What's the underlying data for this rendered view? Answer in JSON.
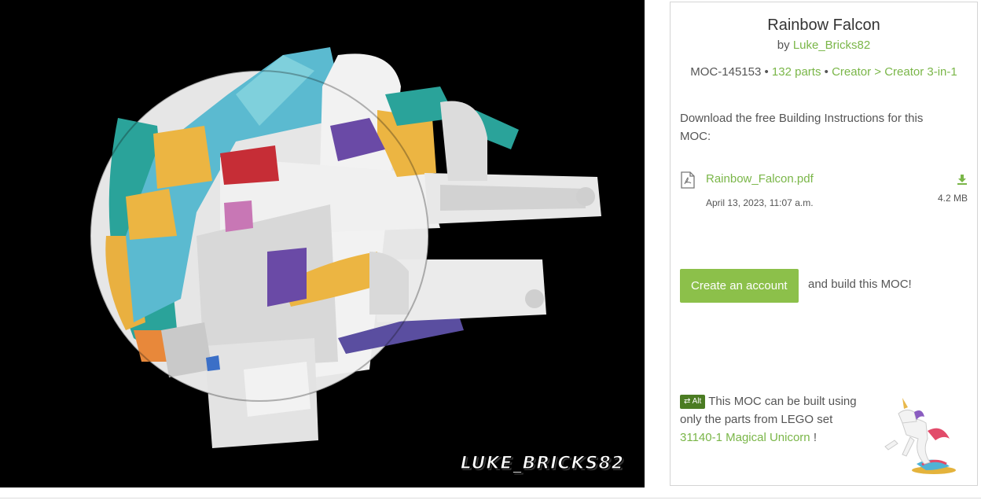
{
  "moc": {
    "title": "Rainbow Falcon",
    "by_prefix": "by",
    "author": "Luke_Bricks82",
    "id": "MOC-145153",
    "separator": "•",
    "parts": "132 parts",
    "category": "Creator > Creator 3-in-1"
  },
  "image": {
    "watermark": "LUKE_BRICKS82"
  },
  "download": {
    "intro": "Download the free Building Instructions for this MOC:",
    "file_name": "Rainbow_Falcon.pdf",
    "file_date": "April 13, 2023, 11:07 a.m.",
    "file_size": "4.2 MB",
    "file_icon": "pdf-file-icon",
    "download_icon": "download-icon"
  },
  "cta": {
    "button_label": "Create an account",
    "after_text": "and build this MOC!"
  },
  "alt": {
    "badge_label": "Alt",
    "badge_icon": "swap-icon",
    "text_before": "This MOC can be built using only the parts from LEGO set",
    "set_link": "31140-1 Magical Unicorn",
    "text_after": "!"
  },
  "colors": {
    "accent": "#7ab648",
    "button": "#8cc04a",
    "badge": "#4b7c23",
    "image_bg": "#000000"
  }
}
